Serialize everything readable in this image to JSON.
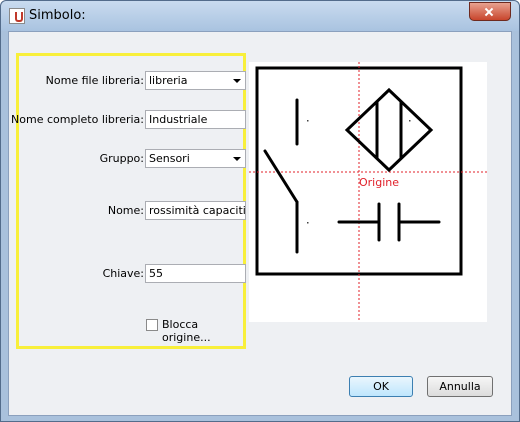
{
  "window": {
    "title": "Simbolo:"
  },
  "form": {
    "library_file_label": "Nome file libreria:",
    "library_file_value": "libreria",
    "library_full_label": "Nome completo libreria:",
    "library_full_value": "Industriale",
    "group_label": "Gruppo:",
    "group_value": "Sensori",
    "name_label": "Nome:",
    "name_value": "rossimità capacitivo",
    "key_label": "Chiave:",
    "key_value": "55",
    "lock_origin_label": "Blocca origine...",
    "lock_origin_checked": false
  },
  "preview": {
    "origin_label": "Origine",
    "origin_color": "#e0202a"
  },
  "buttons": {
    "ok": "OK",
    "cancel": "Annulla"
  },
  "colors": {
    "highlight": "#f8ef3a"
  }
}
